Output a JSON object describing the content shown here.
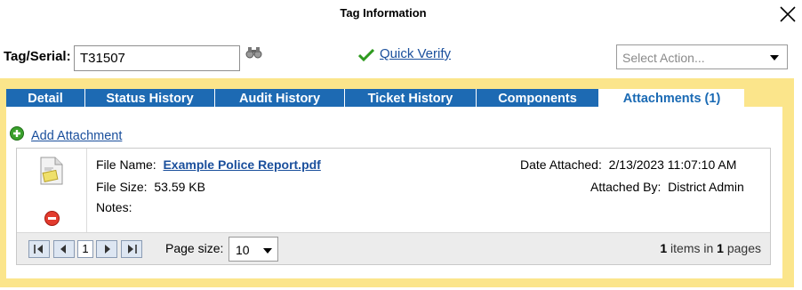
{
  "dialog": {
    "title": "Tag Information"
  },
  "tag": {
    "label": "Tag/Serial:",
    "value": "T31507"
  },
  "quick_verify": {
    "label": "Quick Verify"
  },
  "action_select": {
    "placeholder": "Select Action..."
  },
  "tabs": [
    {
      "label": "Detail",
      "active": false
    },
    {
      "label": "Status History",
      "active": false
    },
    {
      "label": "Audit History",
      "active": false
    },
    {
      "label": "Ticket History",
      "active": false
    },
    {
      "label": "Components",
      "active": false
    },
    {
      "label": "Attachments (1)",
      "active": true
    }
  ],
  "attachments": {
    "add_label": "Add Attachment",
    "items": [
      {
        "file_name_label": "File Name:",
        "file_name": "Example Police Report.pdf",
        "file_size_label": "File Size:",
        "file_size": "53.59 KB",
        "notes_label": "Notes:",
        "notes": "",
        "date_label": "Date Attached:",
        "date": "2/13/2023 11:07:10 AM",
        "by_label": "Attached By:",
        "by": "District Admin"
      }
    ],
    "pager": {
      "current_page": "1",
      "page_size_label": "Page size:",
      "page_size": "10",
      "item_count": "1",
      "items_in_text": "items in",
      "page_count": "1",
      "pages_text": "pages"
    }
  },
  "colors": {
    "tab_bg": "#1d6ab3",
    "frame_bg": "#fbe58b",
    "link": "#1a4f9c"
  },
  "icons": [
    "close-icon",
    "binoculars-icon",
    "check-icon",
    "add-icon",
    "document-icon",
    "delete-icon",
    "first-page-icon",
    "prev-page-icon",
    "next-page-icon",
    "last-page-icon"
  ]
}
